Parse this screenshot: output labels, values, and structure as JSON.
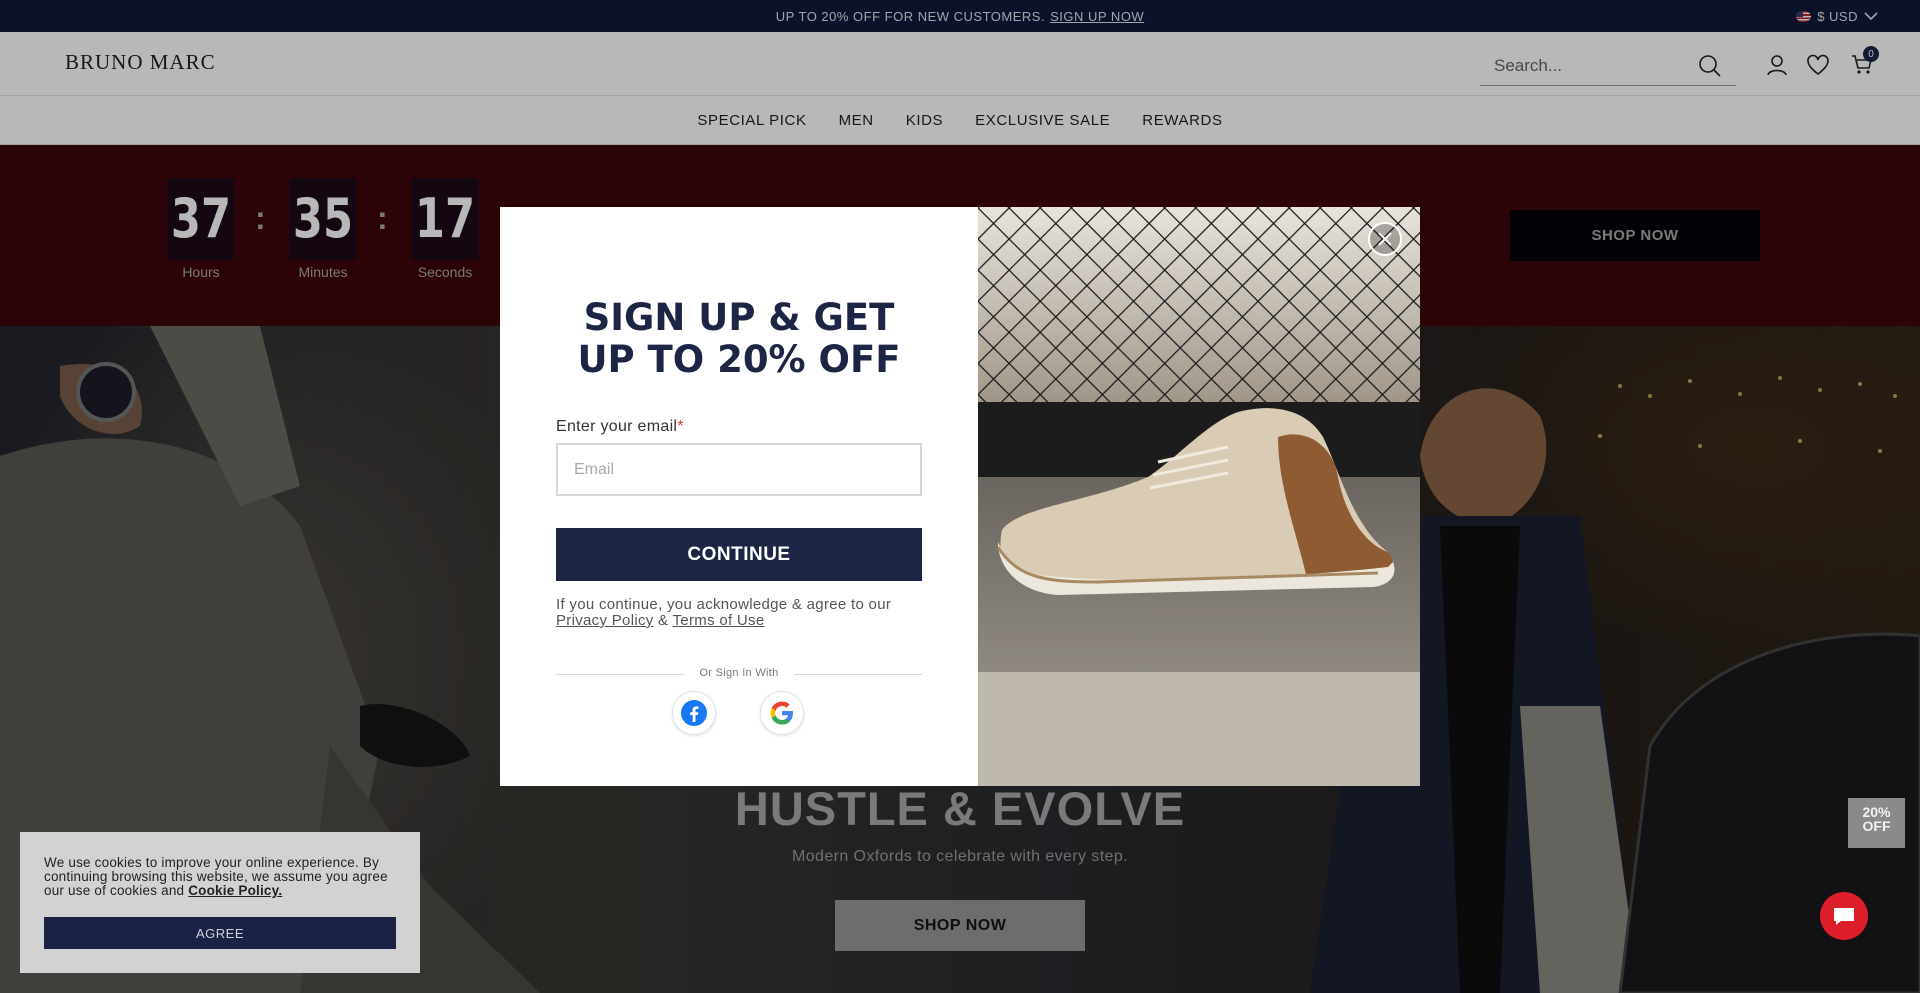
{
  "promo": {
    "text": "UP TO 20% OFF FOR NEW CUSTOMERS.",
    "link": "SIGN UP NOW"
  },
  "currency": {
    "label": "$ USD"
  },
  "header": {
    "logo": "BRUNO MARC",
    "search_placeholder": "Search...",
    "cart_count": "0"
  },
  "nav": {
    "items": [
      "SPECIAL PICK",
      "MEN",
      "KIDS",
      "EXCLUSIVE SALE",
      "REWARDS"
    ]
  },
  "countdown": {
    "hours": "37",
    "minutes": "35",
    "seconds": "17",
    "hours_label": "Hours",
    "minutes_label": "Minutes",
    "seconds_label": "Seconds",
    "separator": ":",
    "shop_label": "SHOP NOW"
  },
  "hero": {
    "title": "HUSTLE & EVOLVE",
    "subtitle": "Modern Oxfords to celebrate with every step.",
    "shop_label": "SHOP NOW"
  },
  "modal": {
    "title_line1": "SIGN UP & GET",
    "title_line2": "UP TO 20% OFF",
    "email_label": "Enter your email",
    "required_mark": "*",
    "email_placeholder": "Email",
    "continue_label": "CONTINUE",
    "terms_prefix": "If you continue, you acknowledge & agree to our",
    "privacy_link": "Privacy Policy",
    "terms_amp": "&",
    "terms_link": "Terms of Use",
    "divider_text": "Or Sign In With",
    "close_symbol": "×"
  },
  "cookie": {
    "text": "We use cookies to improve your online experience. By continuing browsing this website, we assume you agree our use of cookies and",
    "link": "Cookie Policy.",
    "agree_label": "AGREE"
  },
  "side_tab": {
    "line1": "20%",
    "line2": "OFF"
  },
  "colors": {
    "navy": "#1c2543",
    "promo_bar": "#111a3a",
    "band": "#3e0509",
    "chat": "#dc1d2a"
  }
}
